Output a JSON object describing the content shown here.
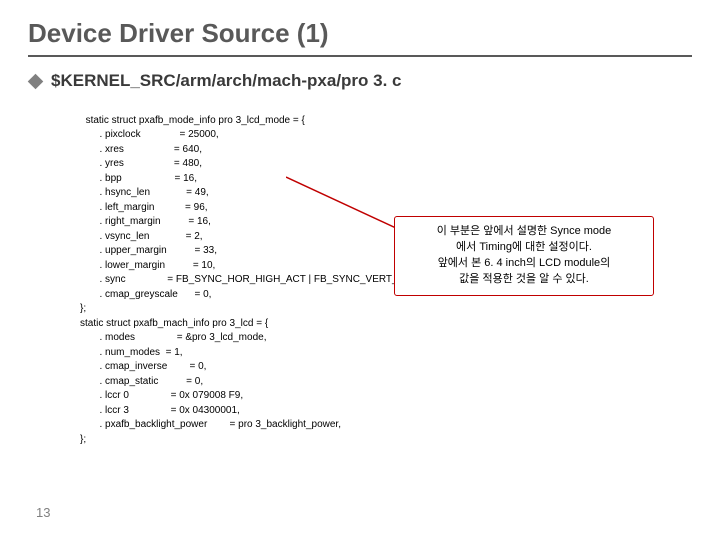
{
  "title": "Device Driver Source (1)",
  "subhead": "$KERNEL_SRC/arm/arch/mach-pxa/pro 3. c",
  "code": "static struct pxafb_mode_info pro 3_lcd_mode = {\n       . pixclock              = 25000,\n       . xres                  = 640,\n       . yres                  = 480,\n       . bpp                   = 16,\n       . hsync_len             = 49,\n       . left_margin           = 96,\n       . right_margin          = 16,\n       . vsync_len             = 2,\n       . upper_margin          = 33,\n       . lower_margin          = 10,\n       . sync               = FB_SYNC_HOR_HIGH_ACT | FB_SYNC_VERT_HIGH_ACT,\n       . cmap_greyscale      = 0,\n};\nstatic struct pxafb_mach_info pro 3_lcd = {\n       . modes               = &pro 3_lcd_mode,\n       . num_modes  = 1,\n       . cmap_inverse        = 0,\n       . cmap_static          = 0,\n       . lccr 0               = 0x 079008 F9,\n       . lccr 3               = 0x 04300001,\n       . pxafb_backlight_power        = pro 3_backlight_power,\n};",
  "callout": {
    "line1": "이 부분은 앞에서 설명한 Synce mode",
    "line2": "에서 Timing에 대한 설정이다.",
    "line3": "앞에서 본 6. 4 inch의 LCD module의",
    "line4": "값을 적용한 것을 알 수 있다."
  },
  "page": "13"
}
